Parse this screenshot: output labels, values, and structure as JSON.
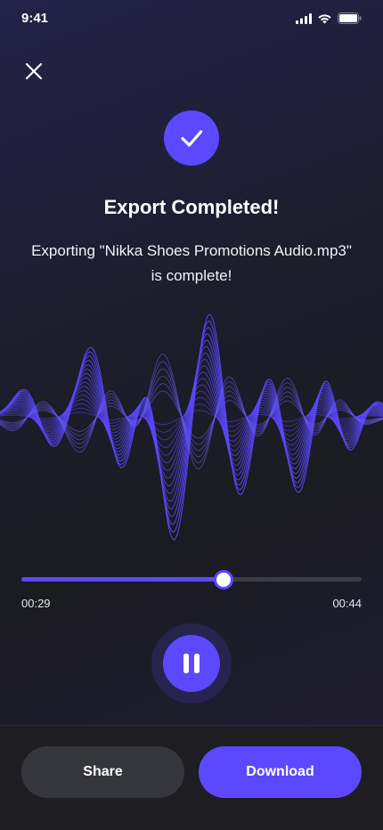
{
  "status_bar": {
    "time": "9:41"
  },
  "header": {
    "close_icon": "close-icon",
    "check_icon": "checkmark-icon"
  },
  "export": {
    "title": "Export Completed!",
    "message_line1": "Exporting \"Nikka Shoes Promotions Audio.mp3\"",
    "message_line2": "is complete!"
  },
  "player": {
    "current_time": "00:29",
    "total_time": "00:44",
    "progress_fraction": 0.595,
    "state_icon": "pause-icon"
  },
  "actions": {
    "share_label": "Share",
    "download_label": "Download"
  },
  "colors": {
    "accent": "#5b48ff",
    "background": "#1c1c24",
    "secondary_button": "#35363b",
    "track": "#3b3b44"
  }
}
